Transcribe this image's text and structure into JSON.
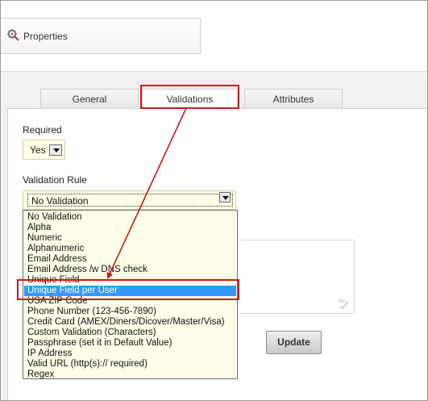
{
  "header": {
    "title": "Properties",
    "icon": "properties-gear-icon"
  },
  "tabs": [
    {
      "label": "General",
      "active": false
    },
    {
      "label": "Validations",
      "active": true
    },
    {
      "label": "Attributes",
      "active": false
    }
  ],
  "form": {
    "required_label": "Required",
    "required_value": "Yes",
    "validation_rule_label": "Validation Rule",
    "validation_rule_value": "No Validation",
    "update_label": "Update"
  },
  "validation_options": [
    "No Validation",
    "Alpha",
    "Numeric",
    "Alphanumeric",
    "Email Address",
    "Email Address /w DNS check",
    "Unique Field",
    "Unique Field per User",
    "USA ZIP Code",
    "Phone Number (123-456-7890)",
    "Credit Card (AMEX/Diners/Dicover/Master/Visa)",
    "Custom Validation (Characters)",
    "Passphrase (set it in Default Value)",
    "IP Address",
    "Valid URL (http(s):// required)",
    "Regex"
  ],
  "highlighted_option": "Unique Field per User",
  "colors": {
    "annotation": "#d6131c",
    "selection": "#3399ff",
    "field_background": "#fffde6"
  }
}
